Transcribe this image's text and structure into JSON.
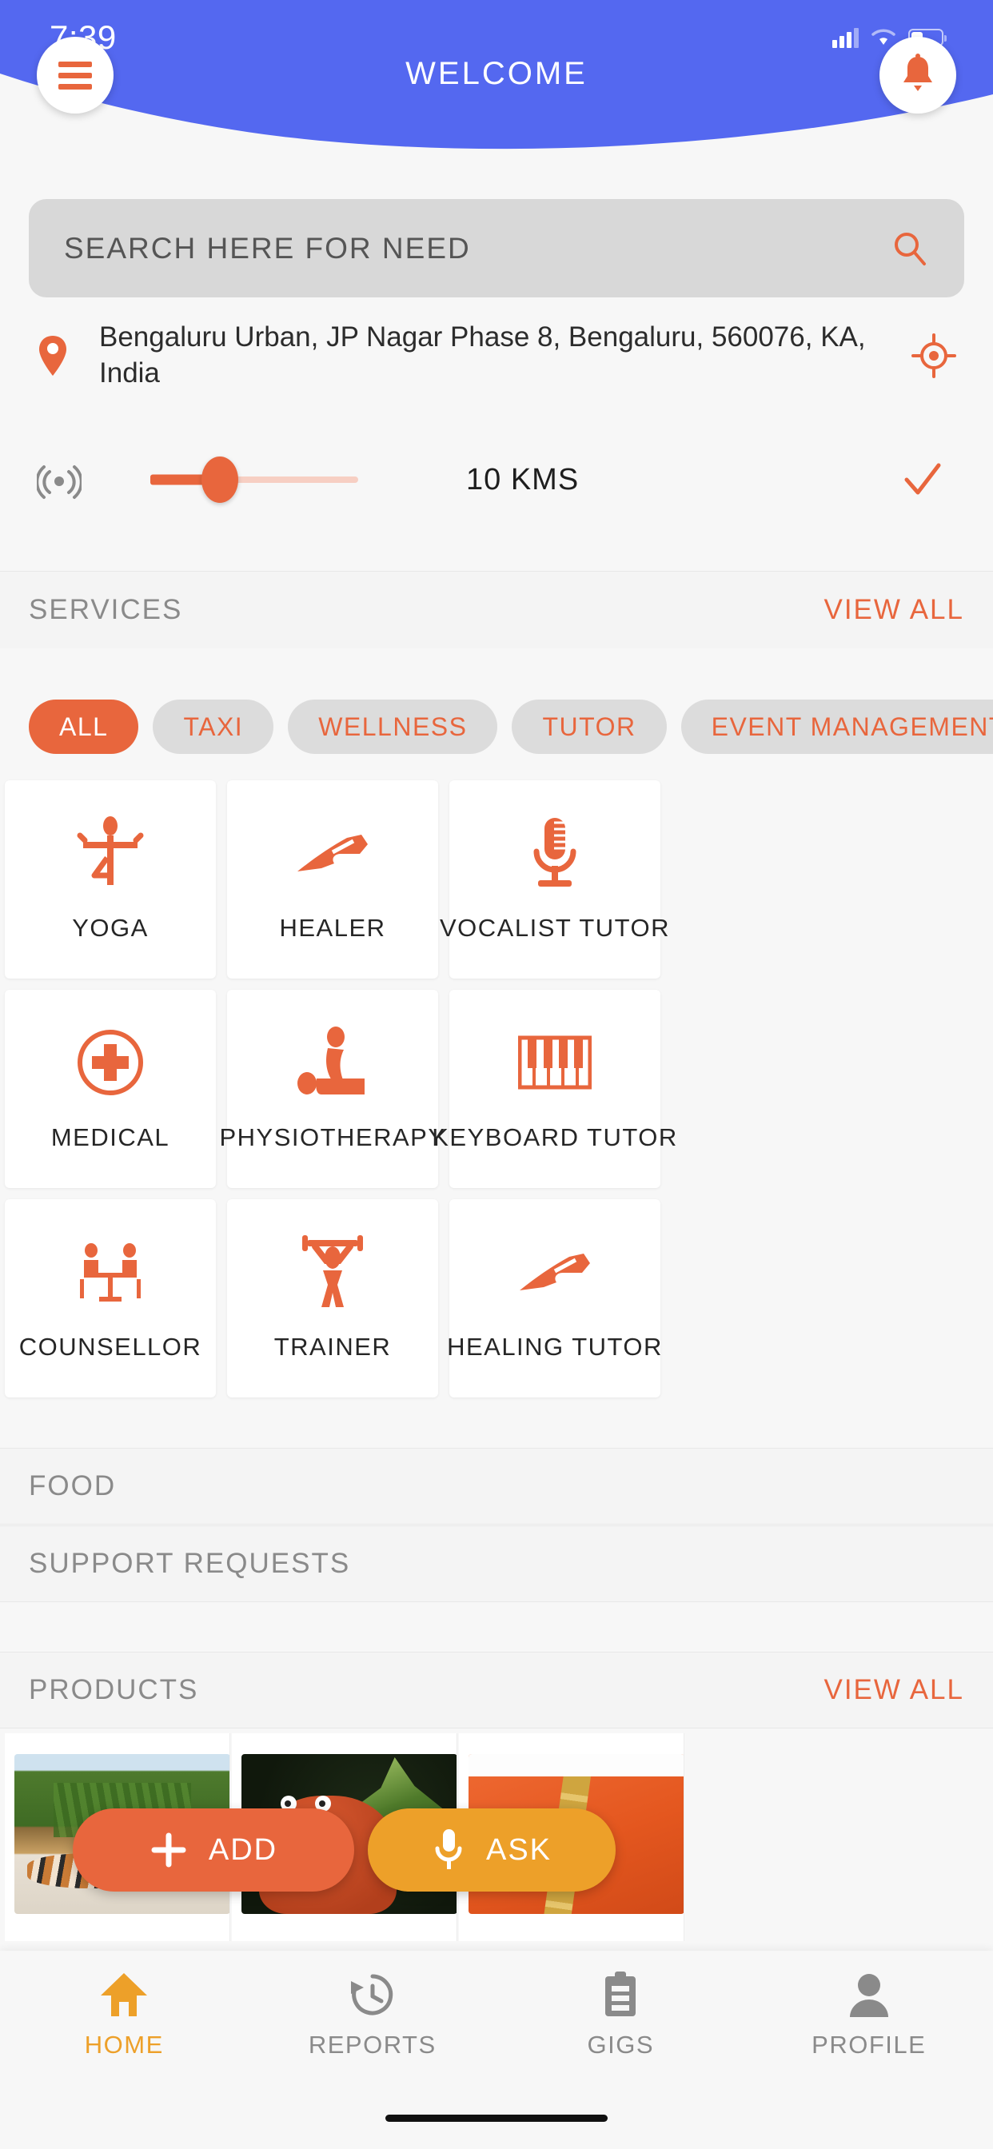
{
  "status_bar": {
    "time": "7:39",
    "signal_icon": "signal-bars-icon",
    "wifi_icon": "wifi-icon",
    "battery_icon": "battery-icon"
  },
  "header": {
    "title": "WELCOME",
    "bg_color": "#5468f0",
    "menu_icon": "hamburger-menu-icon",
    "notification_icon": "bell-icon"
  },
  "search": {
    "placeholder": "SEARCH HERE FOR NEED",
    "value": "",
    "icon": "search-icon"
  },
  "location": {
    "pin_icon": "location-pin-icon",
    "address": "Bengaluru Urban, JP Nagar Phase 8, Bengaluru, 560076, KA, India",
    "gps_icon": "crosshair-locate-icon"
  },
  "distance": {
    "radar_icon": "radar-icon",
    "value_label": "10 KMS",
    "value": 10,
    "min": 0,
    "max": 50,
    "confirm_icon": "check-icon"
  },
  "services_section": {
    "title": "SERVICES",
    "view_all": "VIEW ALL",
    "chips": [
      {
        "label": "ALL",
        "active": true
      },
      {
        "label": "TAXI",
        "active": false
      },
      {
        "label": "WELLNESS",
        "active": false
      },
      {
        "label": "TUTOR",
        "active": false
      },
      {
        "label": "EVENT MANAGEMENT",
        "active": false
      }
    ],
    "cards": [
      {
        "label": "YOGA",
        "icon": "yoga-pose-icon"
      },
      {
        "label": "HEALER",
        "icon": "healing-hand-icon"
      },
      {
        "label": "VOCALIST TUTOR",
        "icon": "microphone-icon"
      },
      {
        "label": "MEDICAL",
        "icon": "medical-cross-icon"
      },
      {
        "label": "PHYSIOTHERAPY",
        "icon": "physiotherapy-icon"
      },
      {
        "label": "KEYBOARD TUTOR",
        "icon": "piano-keyboard-icon"
      },
      {
        "label": "COUNSELLOR",
        "icon": "counselling-table-icon"
      },
      {
        "label": "TRAINER",
        "icon": "weightlifter-icon"
      },
      {
        "label": "HEALING TUTOR",
        "icon": "healing-hand-icon"
      }
    ]
  },
  "food_section": {
    "title": "FOOD"
  },
  "support_section": {
    "title": "SUPPORT REQUESTS"
  },
  "products_section": {
    "title": "PRODUCTS",
    "view_all": "VIEW ALL",
    "items": [
      {
        "image": "tiger-in-grass-photo"
      },
      {
        "image": "red-toy-with-plant-photo"
      },
      {
        "image": "orange-cloth-gold-beads-photo"
      }
    ]
  },
  "floating_actions": [
    {
      "label": "ADD",
      "icon": "plus-icon",
      "color": "#e8663d"
    },
    {
      "label": "ASK",
      "icon": "microphone-icon",
      "color": "#eda029"
    }
  ],
  "bottom_nav": {
    "items": [
      {
        "label": "HOME",
        "icon": "home-icon",
        "active": true
      },
      {
        "label": "REPORTS",
        "icon": "history-clock-icon",
        "active": false
      },
      {
        "label": "GIGS",
        "icon": "clipboard-icon",
        "active": false
      },
      {
        "label": "PROFILE",
        "icon": "person-icon",
        "active": false
      }
    ],
    "active_color": "#eda029",
    "inactive_color": "#8a8a8a"
  },
  "theme": {
    "accent": "#e8663d",
    "amber": "#eda029",
    "header_blue": "#5468f0",
    "page_bg": "#f7f7f7"
  }
}
